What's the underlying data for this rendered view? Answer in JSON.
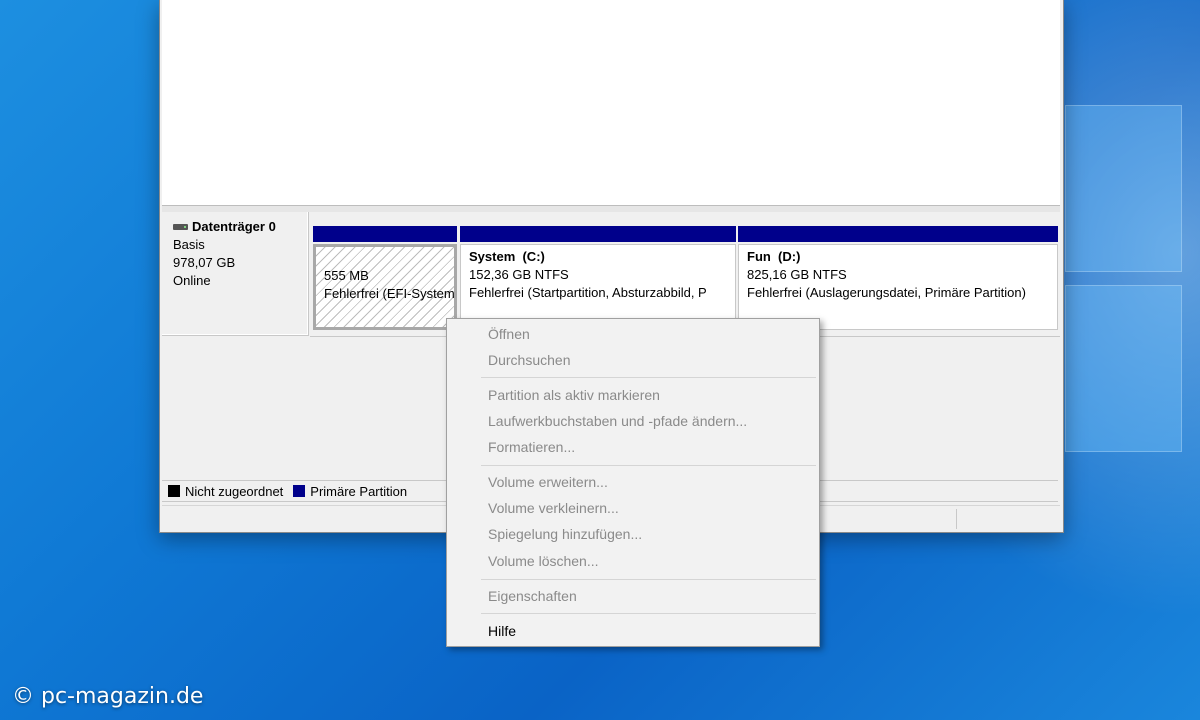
{
  "disk": {
    "name": "Datenträger 0",
    "type": "Basis",
    "size": "978,07 GB",
    "status": "Online"
  },
  "partitions": [
    {
      "title": "",
      "size": "555 MB",
      "status": "Fehlerfrei (EFI-Systempartition)"
    },
    {
      "title": "System  (C:)",
      "size": "152,36 GB NTFS",
      "status": "Fehlerfrei (Startpartition, Absturzabbild, P"
    },
    {
      "title": "Fun  (D:)",
      "size": "825,16 GB NTFS",
      "status": "Fehlerfrei (Auslagerungsdatei, Primäre Partition)"
    }
  ],
  "legend": {
    "unallocated": "Nicht zugeordnet",
    "primary": "Primäre Partition",
    "unallocated_color": "#000000",
    "primary_color": "#00008b"
  },
  "context_menu": {
    "items": [
      {
        "label": "Öffnen",
        "enabled": false
      },
      {
        "label": "Durchsuchen",
        "enabled": false
      },
      {
        "label": "Partition als aktiv markieren",
        "enabled": false
      },
      {
        "label": "Laufwerkbuchstaben und -pfade ändern...",
        "enabled": false
      },
      {
        "label": "Formatieren...",
        "enabled": false
      },
      {
        "label": "Volume erweitern...",
        "enabled": false
      },
      {
        "label": "Volume verkleinern...",
        "enabled": false
      },
      {
        "label": "Spiegelung hinzufügen...",
        "enabled": false
      },
      {
        "label": "Volume löschen...",
        "enabled": false
      },
      {
        "label": "Eigenschaften",
        "enabled": false
      },
      {
        "label": "Hilfe",
        "enabled": true
      }
    ]
  },
  "watermark": "© pc-magazin.de"
}
